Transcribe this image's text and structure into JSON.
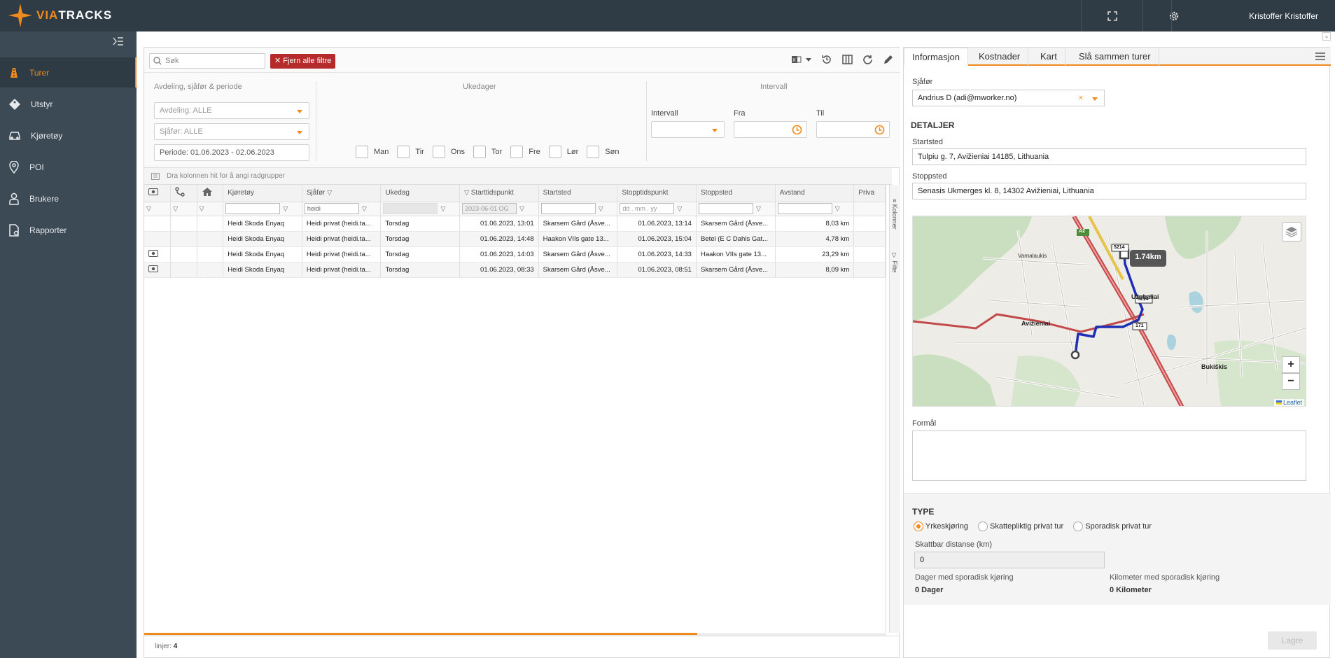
{
  "brand": {
    "name_part1": "VIA",
    "name_part2": "TRACKS"
  },
  "header": {
    "user": "Kristoffer Kristoffer"
  },
  "nav": [
    {
      "label": "Turer",
      "icon": "road-icon"
    },
    {
      "label": "Utstyr",
      "icon": "tag-icon"
    },
    {
      "label": "Kjøretøy",
      "icon": "car-icon"
    },
    {
      "label": "POI",
      "icon": "pin-icon"
    },
    {
      "label": "Brukere",
      "icon": "user-icon"
    },
    {
      "label": "Rapporter",
      "icon": "report-icon"
    }
  ],
  "toolbar": {
    "search_placeholder": "Søk",
    "clear_filters": "Fjern alle filtre"
  },
  "filters": {
    "section1_title": "Avdeling, sjåfør & periode",
    "department": "Avdeling: ALLE",
    "driver": "Sjåfør: ALLE",
    "period": "Periode: 01.06.2023 - 02.06.2023",
    "section2_title": "Ukedager",
    "days": [
      "Man",
      "Tir",
      "Ons",
      "Tor",
      "Fre",
      "Lør",
      "Søn"
    ],
    "section3_title": "Intervall",
    "interval_label": "Intervall",
    "from_label": "Fra",
    "to_label": "Til"
  },
  "grid": {
    "group_hint": "Dra kolonnen hit for å angi radgrupper",
    "columns": [
      "Kjøretøy",
      "Sjåfør",
      "Ukedag",
      "Starttidspunkt",
      "Startsted",
      "Stopptidspunkt",
      "Stoppsted",
      "Avstand",
      "Priva"
    ],
    "filter_values": {
      "driver": "heidi",
      "start": "2023-06-01 OG",
      "stop": "dd . mm . yy"
    },
    "rows": [
      {
        "vehicle": "Heidi Skoda Enyaq",
        "driver": "Heidi privat (heidi.ta...",
        "day": "Torsdag",
        "start_time": "01.06.2023, 13:01",
        "start_place": "Skarsem Gård (Åsve...",
        "stop_time": "01.06.2023, 13:14",
        "stop_place": "Skarsem Gård (Åsve...",
        "distance": "8,03 km",
        "eye": false
      },
      {
        "vehicle": "Heidi Skoda Enyaq",
        "driver": "Heidi privat (heidi.ta...",
        "day": "Torsdag",
        "start_time": "01.06.2023, 14:48",
        "start_place": "Haakon VIIs gate 13...",
        "stop_time": "01.06.2023, 15:04",
        "stop_place": "Betel (E C Dahls Gat...",
        "distance": "4,78 km",
        "eye": false
      },
      {
        "vehicle": "Heidi Skoda Enyaq",
        "driver": "Heidi privat (heidi.ta...",
        "day": "Torsdag",
        "start_time": "01.06.2023, 14:03",
        "start_place": "Skarsem Gård (Åsve...",
        "stop_time": "01.06.2023, 14:33",
        "stop_place": "Haakon VIIs gate 13...",
        "distance": "23,29 km",
        "eye": true
      },
      {
        "vehicle": "Heidi Skoda Enyaq",
        "driver": "Heidi privat (heidi.ta...",
        "day": "Torsdag",
        "start_time": "01.06.2023, 08:33",
        "start_place": "Skarsem Gård (Åsve...",
        "stop_time": "01.06.2023, 08:51",
        "stop_place": "Skarsem Gård (Åsve...",
        "distance": "8,09 km",
        "eye": true
      }
    ],
    "side_tabs": [
      "Kolonner",
      "Filte"
    ],
    "footer_label": "linjer:",
    "footer_count": "4"
  },
  "detail": {
    "tabs": [
      "Informasjon",
      "Kostnader",
      "Kart",
      "Slå sammen turer"
    ],
    "driver_label": "Sjåfør",
    "driver_value": "Andrius D (adi@mworker.no)",
    "details_title": "DETALJER",
    "start_label": "Startsted",
    "start_value": "Tulpiu g. 7, Avižieniai 14185, Lithuania",
    "stop_label": "Stoppsted",
    "stop_value": "Senasis Ukmerges kl. 8, 14302 Avižieniai, Lithuania",
    "map": {
      "distance_badge": "1.74km",
      "attribution": "Leaflet",
      "places": [
        "Varnalaukis",
        "Avižieniai",
        "Užubaliai",
        "Bukiškis"
      ],
      "roads": [
        "A2",
        "5214",
        "171"
      ]
    },
    "purpose_label": "Formål",
    "type_title": "TYPE",
    "type_options": [
      "Yrkeskjøring",
      "Skattepliktig privat tur",
      "Sporadisk privat tur"
    ],
    "taxable_label": "Skattbar distanse (km)",
    "taxable_value": "0",
    "days_label": "Dager med sporadisk kjøring",
    "days_value": "0 Dager",
    "km_label": "Kilometer med sporadisk kjøring",
    "km_value": "0 Kilometer",
    "save_label": "Lagre"
  },
  "colors": {
    "accent": "#f08a1c",
    "topbar": "#2f3b45",
    "sidebar": "#3c4a55",
    "danger": "#b52a2a",
    "route": "#1f2fb5"
  }
}
